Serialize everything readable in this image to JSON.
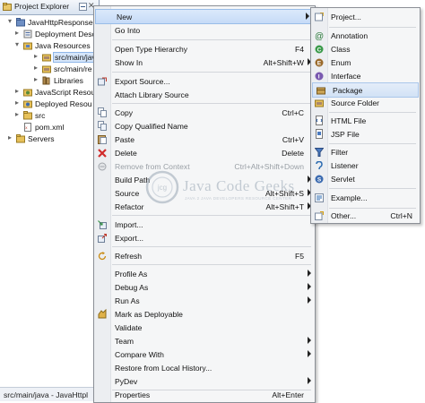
{
  "project_explorer": {
    "title": "Project Explorer",
    "close_glyph": "✕",
    "tree": [
      {
        "label": "JavaHttpResponseH",
        "icon": "project-icon",
        "twisty": "▾"
      },
      {
        "label": "Deployment Desc",
        "icon": "deployment-icon",
        "twisty": "▸"
      },
      {
        "label": "Java Resources",
        "icon": "java-resources-icon",
        "twisty": "▾"
      },
      {
        "label": "src/main/jav",
        "icon": "source-folder-icon",
        "twisty": "▸",
        "selected": true
      },
      {
        "label": "src/main/re",
        "icon": "source-folder-icon",
        "twisty": "▸"
      },
      {
        "label": "Libraries",
        "icon": "libraries-icon",
        "twisty": "▸"
      },
      {
        "label": "JavaScript Resou",
        "icon": "javascript-icon",
        "twisty": "▸"
      },
      {
        "label": "Deployed Resou",
        "icon": "deployed-icon",
        "twisty": "▸"
      },
      {
        "label": "src",
        "icon": "folder-icon",
        "twisty": "▸"
      },
      {
        "label": "pom.xml",
        "icon": "xml-file-icon",
        "twisty": ""
      },
      {
        "label": "Servers",
        "icon": "folder-icon",
        "twisty": "▸"
      }
    ],
    "status": "src/main/java - JavaHttpl"
  },
  "context_menu": {
    "items": [
      {
        "label": "New",
        "shortcut": "",
        "submenu": true,
        "highlighted": true
      },
      {
        "label": "Go Into",
        "shortcut": ""
      },
      {
        "sep": true
      },
      {
        "label": "Open Type Hierarchy",
        "shortcut": "F4"
      },
      {
        "label": "Show In",
        "shortcut": "Alt+Shift+W",
        "submenu": true
      },
      {
        "sep": true
      },
      {
        "label": "Export Source...",
        "shortcut": "",
        "icon": "export-source-icon"
      },
      {
        "label": "Attach Library Source",
        "shortcut": ""
      },
      {
        "sep": true
      },
      {
        "label": "Copy",
        "shortcut": "Ctrl+C",
        "icon": "copy-icon"
      },
      {
        "label": "Copy Qualified Name",
        "shortcut": "",
        "icon": "copy-qualified-icon"
      },
      {
        "label": "Paste",
        "shortcut": "Ctrl+V",
        "icon": "paste-icon"
      },
      {
        "label": "Delete",
        "shortcut": "Delete",
        "icon": "delete-icon"
      },
      {
        "label": "Remove from Context",
        "shortcut": "Ctrl+Alt+Shift+Down",
        "disabled": true,
        "icon": "remove-context-icon"
      },
      {
        "label": "Build Path",
        "shortcut": "",
        "submenu": true
      },
      {
        "label": "Source",
        "shortcut": "Alt+Shift+S",
        "submenu": true
      },
      {
        "label": "Refactor",
        "shortcut": "Alt+Shift+T",
        "submenu": true
      },
      {
        "sep": true
      },
      {
        "label": "Import...",
        "shortcut": "",
        "icon": "import-icon"
      },
      {
        "label": "Export...",
        "shortcut": "",
        "icon": "export-icon"
      },
      {
        "sep": true
      },
      {
        "label": "Refresh",
        "shortcut": "F5",
        "icon": "refresh-icon"
      },
      {
        "sep": true
      },
      {
        "label": "Profile As",
        "shortcut": "",
        "submenu": true
      },
      {
        "label": "Debug As",
        "shortcut": "",
        "submenu": true
      },
      {
        "label": "Run As",
        "shortcut": "",
        "submenu": true
      },
      {
        "label": "Mark as Deployable",
        "shortcut": "",
        "icon": "deployable-icon"
      },
      {
        "label": "Validate",
        "shortcut": ""
      },
      {
        "label": "Team",
        "shortcut": "",
        "submenu": true
      },
      {
        "label": "Compare With",
        "shortcut": "",
        "submenu": true
      },
      {
        "label": "Restore from Local History...",
        "shortcut": ""
      },
      {
        "label": "PyDev",
        "shortcut": "",
        "submenu": true
      },
      {
        "sep": true
      },
      {
        "label": "Properties",
        "shortcut": "Alt+Enter"
      }
    ]
  },
  "new_submenu": {
    "items": [
      {
        "label": "Project...",
        "shortcut": "",
        "icon": "project-wizard-icon"
      },
      {
        "sep": true
      },
      {
        "label": "Annotation",
        "shortcut": "",
        "icon": "annotation-icon"
      },
      {
        "label": "Class",
        "shortcut": "",
        "icon": "class-icon"
      },
      {
        "label": "Enum",
        "shortcut": "",
        "icon": "enum-icon"
      },
      {
        "label": "Interface",
        "shortcut": "",
        "icon": "interface-icon"
      },
      {
        "label": "Package",
        "shortcut": "",
        "icon": "package-icon",
        "highlighted": true
      },
      {
        "label": "Source Folder",
        "shortcut": "",
        "icon": "new-source-folder-icon"
      },
      {
        "sep": true
      },
      {
        "label": "HTML File",
        "shortcut": "",
        "icon": "html-file-icon"
      },
      {
        "label": "JSP File",
        "shortcut": "",
        "icon": "jsp-file-icon"
      },
      {
        "sep": true
      },
      {
        "label": "Filter",
        "shortcut": "",
        "icon": "filter-icon"
      },
      {
        "label": "Listener",
        "shortcut": "",
        "icon": "listener-icon"
      },
      {
        "label": "Servlet",
        "shortcut": "",
        "icon": "servlet-icon"
      },
      {
        "sep": true
      },
      {
        "label": "Example...",
        "shortcut": "",
        "icon": "example-icon"
      },
      {
        "sep": true
      },
      {
        "label": "Other...",
        "shortcut": "Ctrl+N",
        "icon": "other-wizard-icon"
      }
    ]
  },
  "watermark": {
    "logo_text": "jcg",
    "brand": "Java Code Geeks",
    "tagline": "JAVA 2 JAVA DEVELOPERS RESOURCE CENTER"
  },
  "colors": {
    "highlight": "#c6dbf7",
    "menu_bg": "#f5f6f7",
    "package_icon": "#b08a3e",
    "class_icon": "#2f8a3a",
    "enum_icon": "#8a5a2b",
    "interface_icon": "#6b4fa0",
    "delete_icon": "#d12b2b"
  }
}
